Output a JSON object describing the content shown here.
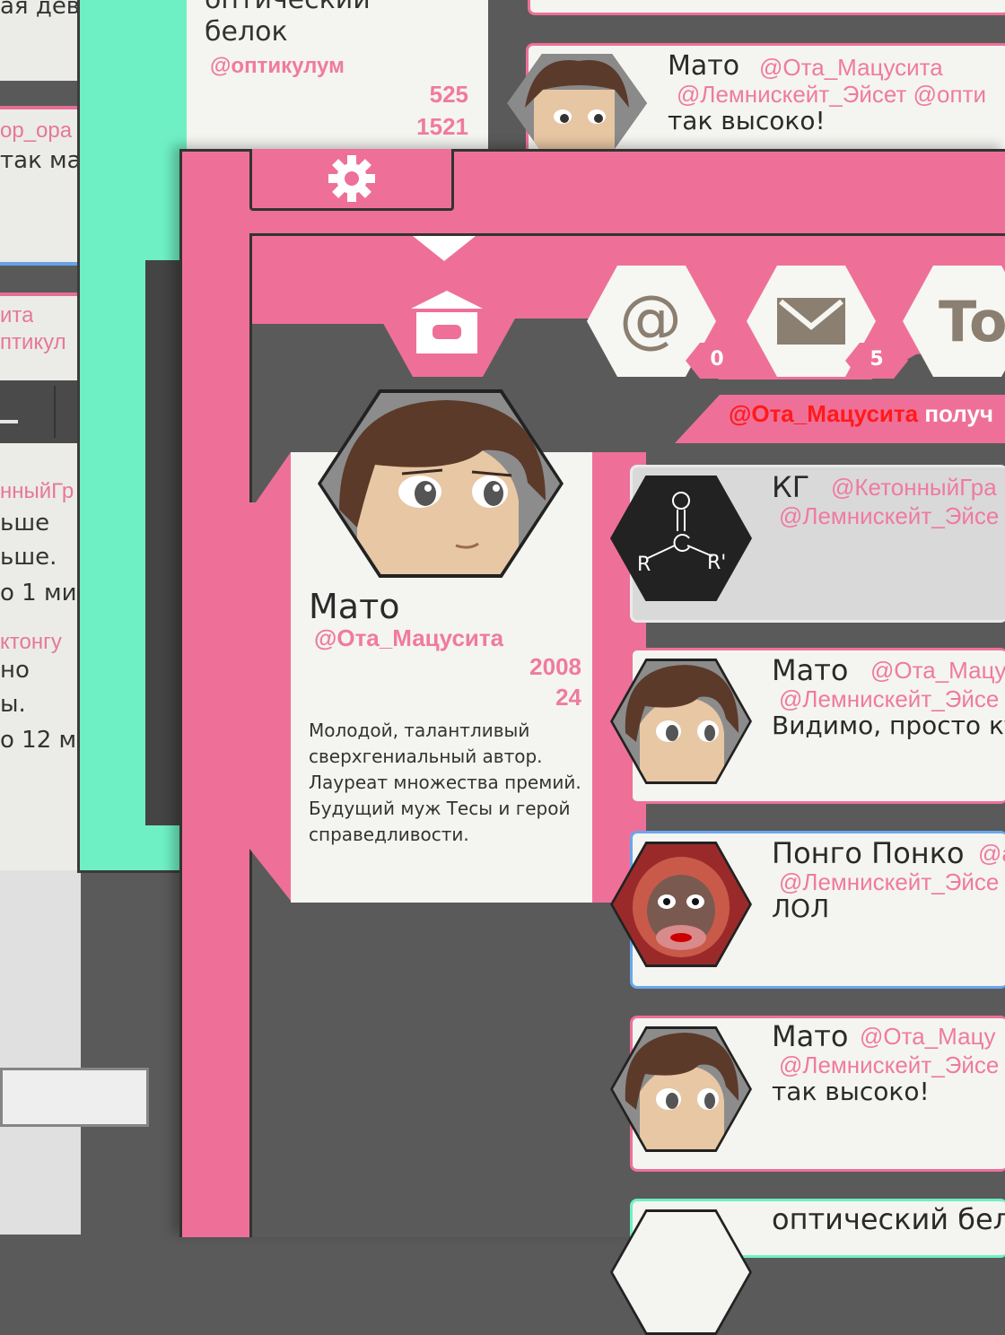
{
  "back_left": {
    "lines": [
      "ая дев",
      "ор_ора",
      "так ма",
      "ита",
      "птикул",
      "нныйГр",
      "ьше",
      "ьше.",
      "о 1 ми",
      "ктонгу",
      "но",
      "ы.",
      "о 12 ми"
    ]
  },
  "back_center": {
    "text_top": "оптический",
    "text_line2": "белок",
    "handle": "@оптикулум",
    "stat1": "525",
    "stat2": "1521"
  },
  "back_tweet": {
    "name": "Мато",
    "handle": "@Ота_Мацусита",
    "reply_to": "@Лемнискейт_Эйсет @опти",
    "text": "так высоко!"
  },
  "toolbar": {
    "settings_icon": "gear-icon"
  },
  "tabs": {
    "home_icon": "home-icon",
    "mentions_glyph": "@",
    "mentions_count": "0",
    "messages_count": "5",
    "topics_label": "To"
  },
  "notice": {
    "handle": "@Ота_Мацусита",
    "text": "получ"
  },
  "profile": {
    "name": "Мато",
    "handle": "@Ота_Мацусита",
    "stat1": "2008",
    "stat2": "24",
    "bio": [
      "Молодой, талантливый",
      "сверхгениальный автор.",
      "Лауреат множества премий.",
      "Будущий муж Тесы и герой",
      "справедливости."
    ]
  },
  "feed": [
    {
      "name": "КГ",
      "handle": "@КетонныйГра",
      "reply_to": "@Лемнискейт_Эйсе",
      "text": "",
      "avatar": "ketone-structure"
    },
    {
      "name": "Мато",
      "handle": "@Ота_Мацу",
      "reply_to": "@Лемнискейт_Эйсе",
      "text": "Видимо, просто кт",
      "avatar": "mato"
    },
    {
      "name": "Понго Понко",
      "handle": "@а",
      "reply_to": "@Лемнискейт_Эйсе",
      "text": "ЛОЛ",
      "avatar": "orangutan"
    },
    {
      "name": "Мато",
      "handle": "@Ота_Мацу",
      "reply_to": "@Лемнискейт_Эйсе",
      "text": "так высоко!",
      "avatar": "mato"
    },
    {
      "name": "оптический бел",
      "handle": "",
      "reply_to": "",
      "text": "",
      "avatar": "partial"
    }
  ],
  "colors": {
    "pink": "#ee7099",
    "mint": "#6ff0c4",
    "dark": "#5a5a5a",
    "panel": "#f4f5f0",
    "alert": "#ff1a1a"
  }
}
